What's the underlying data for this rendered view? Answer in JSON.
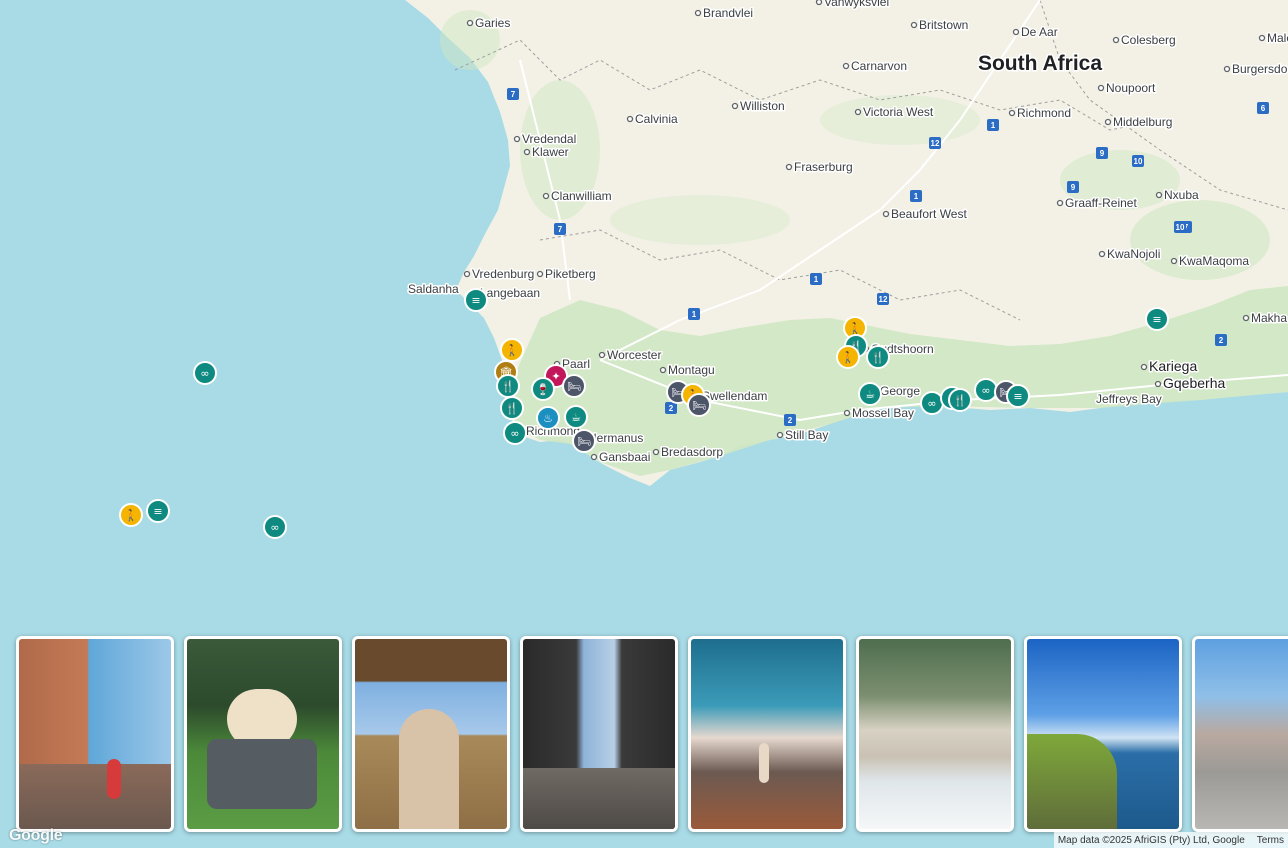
{
  "map": {
    "country_label": "South Africa",
    "places": [
      {
        "name": "Garies"
      },
      {
        "name": "Brandvlei"
      },
      {
        "name": "Vanwyksvlei"
      },
      {
        "name": "Britstown"
      },
      {
        "name": "De Aar"
      },
      {
        "name": "Colesberg"
      },
      {
        "name": "Male"
      },
      {
        "name": "Carnarvon"
      },
      {
        "name": "Noupoort"
      },
      {
        "name": "Burgersdo"
      },
      {
        "name": "Williston"
      },
      {
        "name": "Victoria West"
      },
      {
        "name": "Richmond"
      },
      {
        "name": "Calvinia"
      },
      {
        "name": "Middelburg"
      },
      {
        "name": "Vredendal"
      },
      {
        "name": "Klawer"
      },
      {
        "name": "Fraserburg"
      },
      {
        "name": "Graaff-Reinet"
      },
      {
        "name": "Nxuba"
      },
      {
        "name": "Clanwilliam"
      },
      {
        "name": "Beaufort West"
      },
      {
        "name": "KwaNojoli"
      },
      {
        "name": "KwaMaqoma"
      },
      {
        "name": "Vredenburg"
      },
      {
        "name": "Piketberg"
      },
      {
        "name": "Saldanha"
      },
      {
        "name": "Langebaan"
      },
      {
        "name": "Makha"
      },
      {
        "name": "Paarl"
      },
      {
        "name": "Worcester"
      },
      {
        "name": "Montagu"
      },
      {
        "name": "Oudtshoorn"
      },
      {
        "name": "Kariega"
      },
      {
        "name": "Gqeberha"
      },
      {
        "name": "Swellendam"
      },
      {
        "name": "George"
      },
      {
        "name": "Jeffreys Bay"
      },
      {
        "name": "Mossel Bay"
      },
      {
        "name": "Hermanus"
      },
      {
        "name": "Still Bay"
      },
      {
        "name": "Richmond"
      },
      {
        "name": "Gansbaai"
      },
      {
        "name": "Bredasdorp"
      }
    ],
    "route_shields": [
      "7",
      "7",
      "7",
      "1",
      "1",
      "1",
      "12",
      "12",
      "9",
      "9",
      "10",
      "10",
      "6",
      "1",
      "2",
      "2",
      "2"
    ],
    "pins": [
      {
        "kind": "binoculars",
        "color": "#0f8a80",
        "icon": "binoculars-icon"
      },
      {
        "kind": "hiking",
        "color": "#f4b400",
        "icon": "hiking-icon"
      },
      {
        "kind": "tour",
        "color": "#0f8a80",
        "icon": "tour-icon"
      },
      {
        "kind": "binoculars",
        "color": "#0f8a80",
        "icon": "binoculars-icon"
      },
      {
        "kind": "tour",
        "color": "#0f8a80",
        "icon": "tour-icon"
      },
      {
        "kind": "hiking",
        "color": "#f4b400",
        "icon": "hiking-icon"
      },
      {
        "kind": "museum",
        "color": "#b07d10",
        "icon": "museum-icon"
      },
      {
        "kind": "nightlife",
        "color": "#c2185b",
        "icon": "nightlife-icon"
      },
      {
        "kind": "restaurant",
        "color": "#0f8a80",
        "icon": "restaurant-icon"
      },
      {
        "kind": "hotel",
        "color": "#4d5569",
        "icon": "hotel-icon"
      },
      {
        "kind": "winery",
        "color": "#0f8a80",
        "icon": "winery-icon"
      },
      {
        "kind": "restaurant",
        "color": "#0f8a80",
        "icon": "restaurant-icon"
      },
      {
        "kind": "spa",
        "color": "#1a8fc0",
        "icon": "spa-icon"
      },
      {
        "kind": "cafe",
        "color": "#0f8a80",
        "icon": "cafe-icon"
      },
      {
        "kind": "binoculars",
        "color": "#0f8a80",
        "icon": "binoculars-icon"
      },
      {
        "kind": "hotel",
        "color": "#4d5569",
        "icon": "hotel-icon"
      },
      {
        "kind": "hotel",
        "color": "#4d5569",
        "icon": "hotel-icon"
      },
      {
        "kind": "hiking",
        "color": "#f4b400",
        "icon": "hiking-icon"
      },
      {
        "kind": "hotel",
        "color": "#4d5569",
        "icon": "hotel-icon"
      },
      {
        "kind": "hiking",
        "color": "#f4b400",
        "icon": "hiking-icon"
      },
      {
        "kind": "restaurant",
        "color": "#0f8a80",
        "icon": "restaurant-icon"
      },
      {
        "kind": "hiking",
        "color": "#f4b400",
        "icon": "hiking-icon"
      },
      {
        "kind": "restaurant",
        "color": "#0f8a80",
        "icon": "restaurant-icon"
      },
      {
        "kind": "cafe",
        "color": "#0f8a80",
        "icon": "cafe-icon"
      },
      {
        "kind": "binoculars",
        "color": "#0f8a80",
        "icon": "binoculars-icon"
      },
      {
        "kind": "binoculars",
        "color": "#0f8a80",
        "icon": "binoculars-icon"
      },
      {
        "kind": "restaurant",
        "color": "#0f8a80",
        "icon": "restaurant-icon"
      },
      {
        "kind": "binoculars",
        "color": "#0f8a80",
        "icon": "binoculars-icon"
      },
      {
        "kind": "hotel",
        "color": "#4d5569",
        "icon": "hotel-icon"
      },
      {
        "kind": "tour",
        "color": "#0f8a80",
        "icon": "tour-icon"
      },
      {
        "kind": "tour",
        "color": "#0f8a80",
        "icon": "tour-icon"
      }
    ]
  },
  "photos": [
    {
      "name": "photo-penguins-boulders",
      "caption": ""
    },
    {
      "name": "photo-picnic-friends",
      "caption": ""
    },
    {
      "name": "photo-safari-vehicle",
      "caption": ""
    },
    {
      "name": "photo-sea-cave",
      "caption": ""
    },
    {
      "name": "photo-mountain-summit",
      "caption": ""
    },
    {
      "name": "photo-beach-waves",
      "caption": ""
    },
    {
      "name": "photo-coastal-cliffs",
      "caption": ""
    },
    {
      "name": "photo-city-street",
      "caption": ""
    }
  ],
  "footer": {
    "logo": "Google",
    "attribution": "Map data ©2025 AfriGIS (Pty) Ltd, Google",
    "terms": "Terms"
  },
  "colors": {
    "water": "#a8dbe6",
    "land": "#f3f1e6",
    "green": "#cfe7c2",
    "teal_pin": "#0f8a80",
    "yellow_pin": "#f4b400",
    "slate_pin": "#4d5569"
  }
}
